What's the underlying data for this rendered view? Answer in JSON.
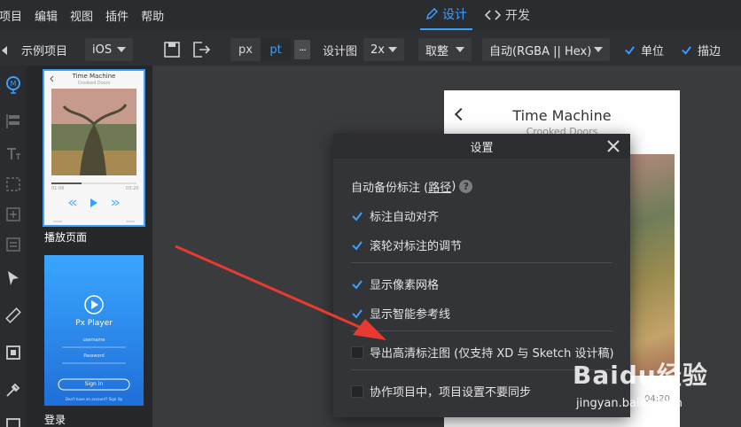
{
  "menubar": {
    "items": [
      "项目",
      "编辑",
      "视图",
      "插件",
      "帮助"
    ],
    "mode_design": "设计",
    "mode_develop": "开发"
  },
  "toolbar": {
    "project_name": "示例项目",
    "platform": "iOS",
    "unit_px": "px",
    "unit_pt": "pt",
    "more": "···",
    "design_label": "设计图",
    "scale": "2x",
    "rounding": "取整",
    "color_format": "自动(RGBA || Hex)",
    "check_unit": "单位",
    "check_stroke": "描边"
  },
  "artboards": [
    {
      "label": "播放页面",
      "selected": true
    },
    {
      "label": "登录",
      "selected": false
    }
  ],
  "thumb1": {
    "title": "Time Machine",
    "subtitle": "Crooked Doors",
    "time_left": "01:06",
    "time_right": "03:20"
  },
  "thumb2": {
    "app_name": "Px Player",
    "username": "username",
    "password": "Password",
    "signin": "Sign in",
    "footer": "Don't have an account? Sign Up"
  },
  "artboard": {
    "title": "Time Machine",
    "subtitle": "Crooked Doors",
    "time": "04:20"
  },
  "settings": {
    "title": "设置",
    "backup_prefix": "自动备份标注 (",
    "backup_link": "路径",
    "backup_suffix": ")",
    "help": "?",
    "opt_auto_align": "标注自动对齐",
    "opt_scroll_adjust": "滚轮对标注的调节",
    "opt_pixel_grid": "显示像素网格",
    "opt_smart_guides": "显示智能参考线",
    "opt_export_hd": "导出高清标注图 (仅支持 XD 与 Sketch 设计稿)",
    "opt_no_sync": "协作项目中，项目设置不要同步"
  },
  "watermark": {
    "brand": "Baidu经验",
    "url": "jingyan.baidu.com"
  },
  "colors": {
    "accent": "#3aa0ff",
    "arrow": "#e83a30",
    "modal_bg": "#333437"
  }
}
